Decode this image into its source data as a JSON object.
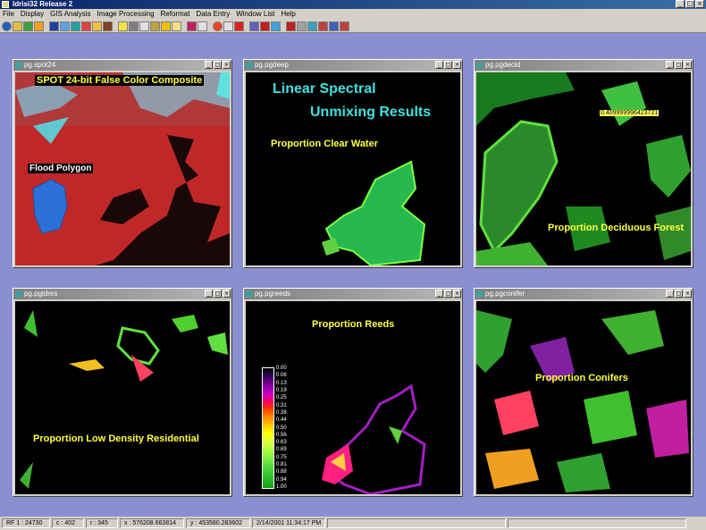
{
  "app": {
    "title": "Idrisi32     Release 2"
  },
  "menu": [
    "File",
    "Display",
    "GIS Analysis",
    "Image Processing",
    "Reformat",
    "Data Entry",
    "Window List",
    "Help"
  ],
  "window_buttons": {
    "minimize": "_",
    "maximize": "□",
    "close": "×"
  },
  "windows": [
    {
      "title": "pg.spot24",
      "labels": [
        "SPOT 24-bit False Color Composite",
        "Flood Polygon"
      ]
    },
    {
      "title": "pg.pgdeep",
      "labels": [
        "Linear Spectral",
        "Unmixing Results",
        "Proportion Clear Water"
      ]
    },
    {
      "title": "pg.pgdecid",
      "labels": [
        "0.409999996423721",
        "Proportion Deciduous Forest"
      ]
    },
    {
      "title": "pg.pgldres",
      "labels": [
        "Proportion Low Density Residential"
      ]
    },
    {
      "title": "pg.pgreeds",
      "labels": [
        "Proportion Reeds"
      ]
    },
    {
      "title": "pg.pgconifer",
      "labels": [
        "Proportion Conifers"
      ]
    }
  ],
  "legend": [
    "0.00",
    "0.06",
    "0.13",
    "0.19",
    "0.25",
    "0.31",
    "0.38",
    "0.44",
    "0.50",
    "0.56",
    "0.63",
    "0.69",
    "0.75",
    "0.81",
    "0.88",
    "0.94",
    "1.00"
  ],
  "status": {
    "rf": "RF 1 : 24730",
    "col": "c : 402",
    "row": "r : 345",
    "x": "x : 576208.663814",
    "y": "y : 453580.283602",
    "datetime": "2/14/2001 11:34:17 PM"
  },
  "colors": {
    "desktop": "#8a8fd0",
    "titlebar": "#0a246a",
    "label_yellow": "#ffff40",
    "label_cyan": "#40e0e0"
  }
}
